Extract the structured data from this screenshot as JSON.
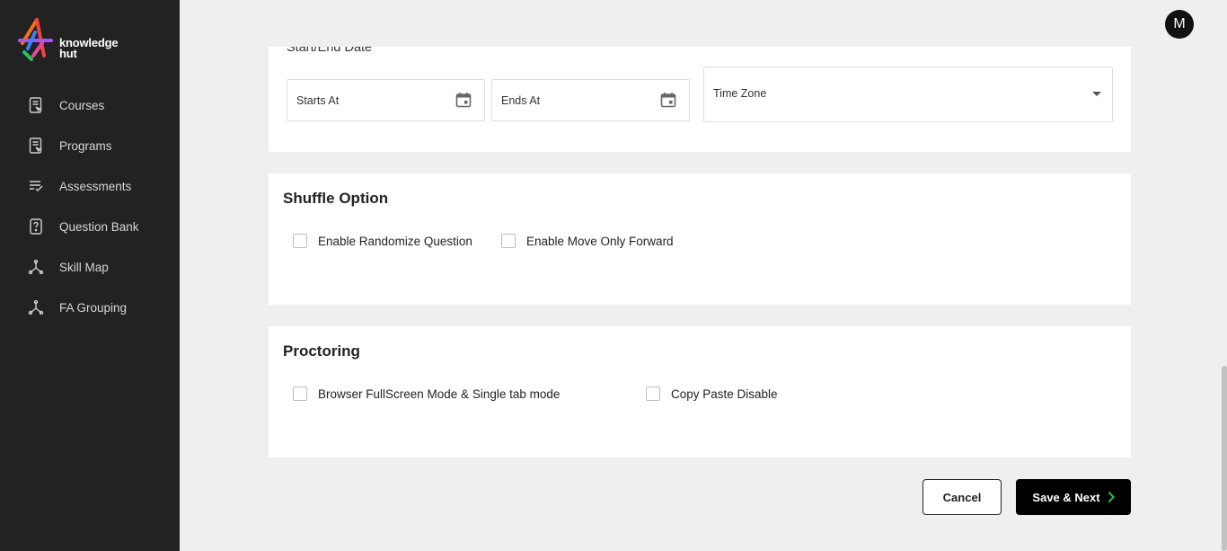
{
  "brand": {
    "line1": "knowledge",
    "line2": "hut"
  },
  "sidebar": {
    "items": [
      {
        "label": "Courses",
        "icon": "course-doc-icon"
      },
      {
        "label": "Programs",
        "icon": "program-doc-icon"
      },
      {
        "label": "Assessments",
        "icon": "checklist-icon"
      },
      {
        "label": "Question Bank",
        "icon": "question-icon"
      },
      {
        "label": "Skill Map",
        "icon": "network-icon"
      },
      {
        "label": "FA Grouping",
        "icon": "network-icon"
      }
    ]
  },
  "user": {
    "initial": "M"
  },
  "date_section": {
    "title": "Start/End Date",
    "starts_placeholder": "Starts At",
    "ends_placeholder": "Ends At",
    "timezone_placeholder": "Time Zone"
  },
  "shuffle": {
    "title": "Shuffle Option",
    "options": [
      "Enable Randomize Question",
      "Enable Move Only Forward"
    ]
  },
  "proctoring": {
    "title": "Proctoring",
    "options": [
      "Browser FullScreen Mode & Single tab mode",
      "Copy Paste Disable"
    ]
  },
  "actions": {
    "cancel": "Cancel",
    "save": "Save & Next"
  },
  "colors": {
    "sidebar_bg": "#222222",
    "page_bg": "#efefef",
    "primary": "#000000",
    "accent": "#22c55e"
  }
}
